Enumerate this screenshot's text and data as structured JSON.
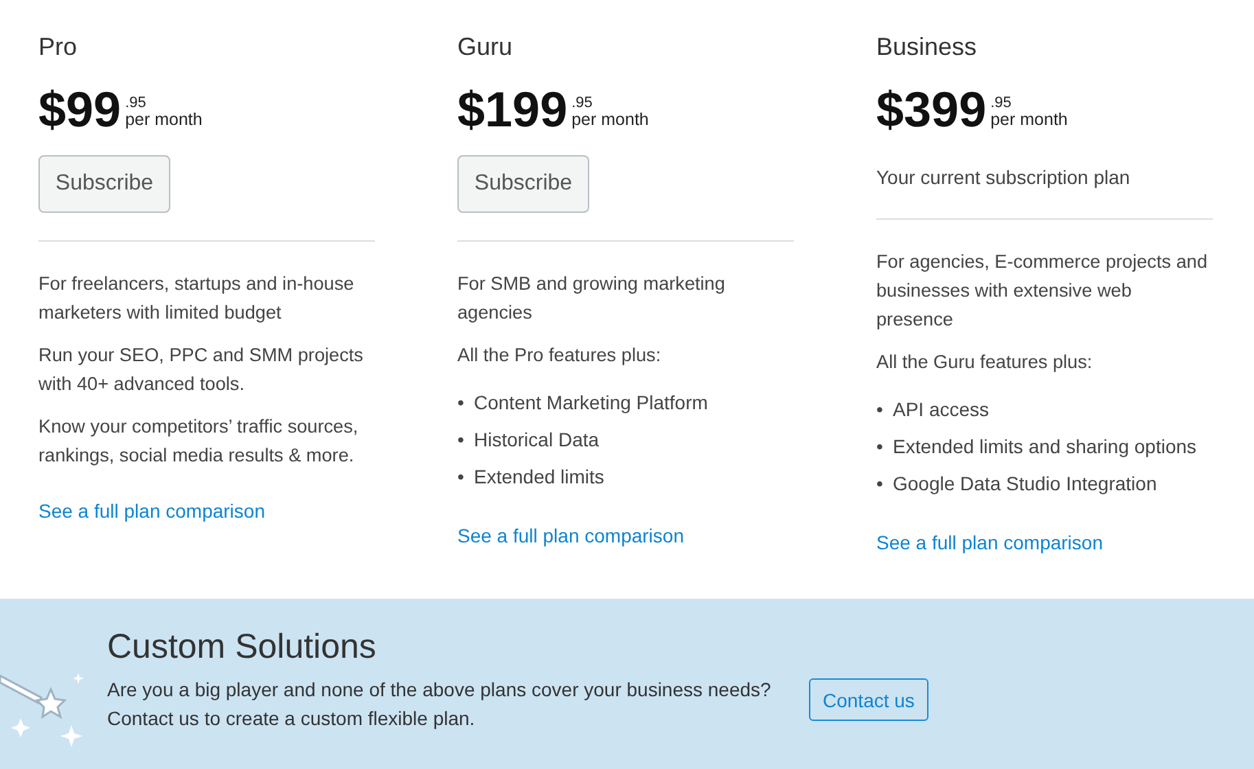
{
  "plans": [
    {
      "name": "Pro",
      "price": "$99",
      "cents": ".95",
      "period": "per month",
      "kind": "subscribe",
      "button": "Subscribe",
      "paragraphs": [
        "For freelancers, startups and in-house marketers with limited budget",
        "Run your SEO, PPC and SMM projects with 40+ advanced tools.",
        "Know your competitors’ traffic sources, rankings, social media results & more."
      ],
      "link": "See a full plan comparison"
    },
    {
      "name": "Guru",
      "price": "$199",
      "cents": ".95",
      "period": "per month",
      "kind": "subscribe",
      "button": "Subscribe",
      "paragraphs": [
        "For SMB and growing marketing agencies",
        "All the Pro features plus:"
      ],
      "features": [
        {
          "bullet": "•",
          "text": "Content Marketing Platform"
        },
        {
          "bullet": "•",
          "text": "Historical Data"
        },
        {
          "bullet": "•",
          "text": "Extended limits"
        }
      ],
      "link": "See a full plan comparison"
    },
    {
      "name": "Business",
      "price": "$399",
      "cents": ".95",
      "period": "per month",
      "kind": "current",
      "note": "Your current subscription plan",
      "paragraphs": [
        "For agencies, E-commerce projects and businesses with extensive web presence",
        "All the Guru features plus:"
      ],
      "features": [
        {
          "bullet": "•",
          "text": "API access"
        },
        {
          "bullet": "•",
          "text": "Extended limits and sharing options"
        },
        {
          "bullet": "•",
          "text": "Google Data Studio Integration"
        }
      ],
      "link": "See a full plan comparison"
    }
  ],
  "custom": {
    "title": "Custom Solutions",
    "text": [
      "Are you a big player and none of the above plans cover your business needs?",
      "Contact us to create a custom flexible plan."
    ],
    "button": "Contact us"
  }
}
